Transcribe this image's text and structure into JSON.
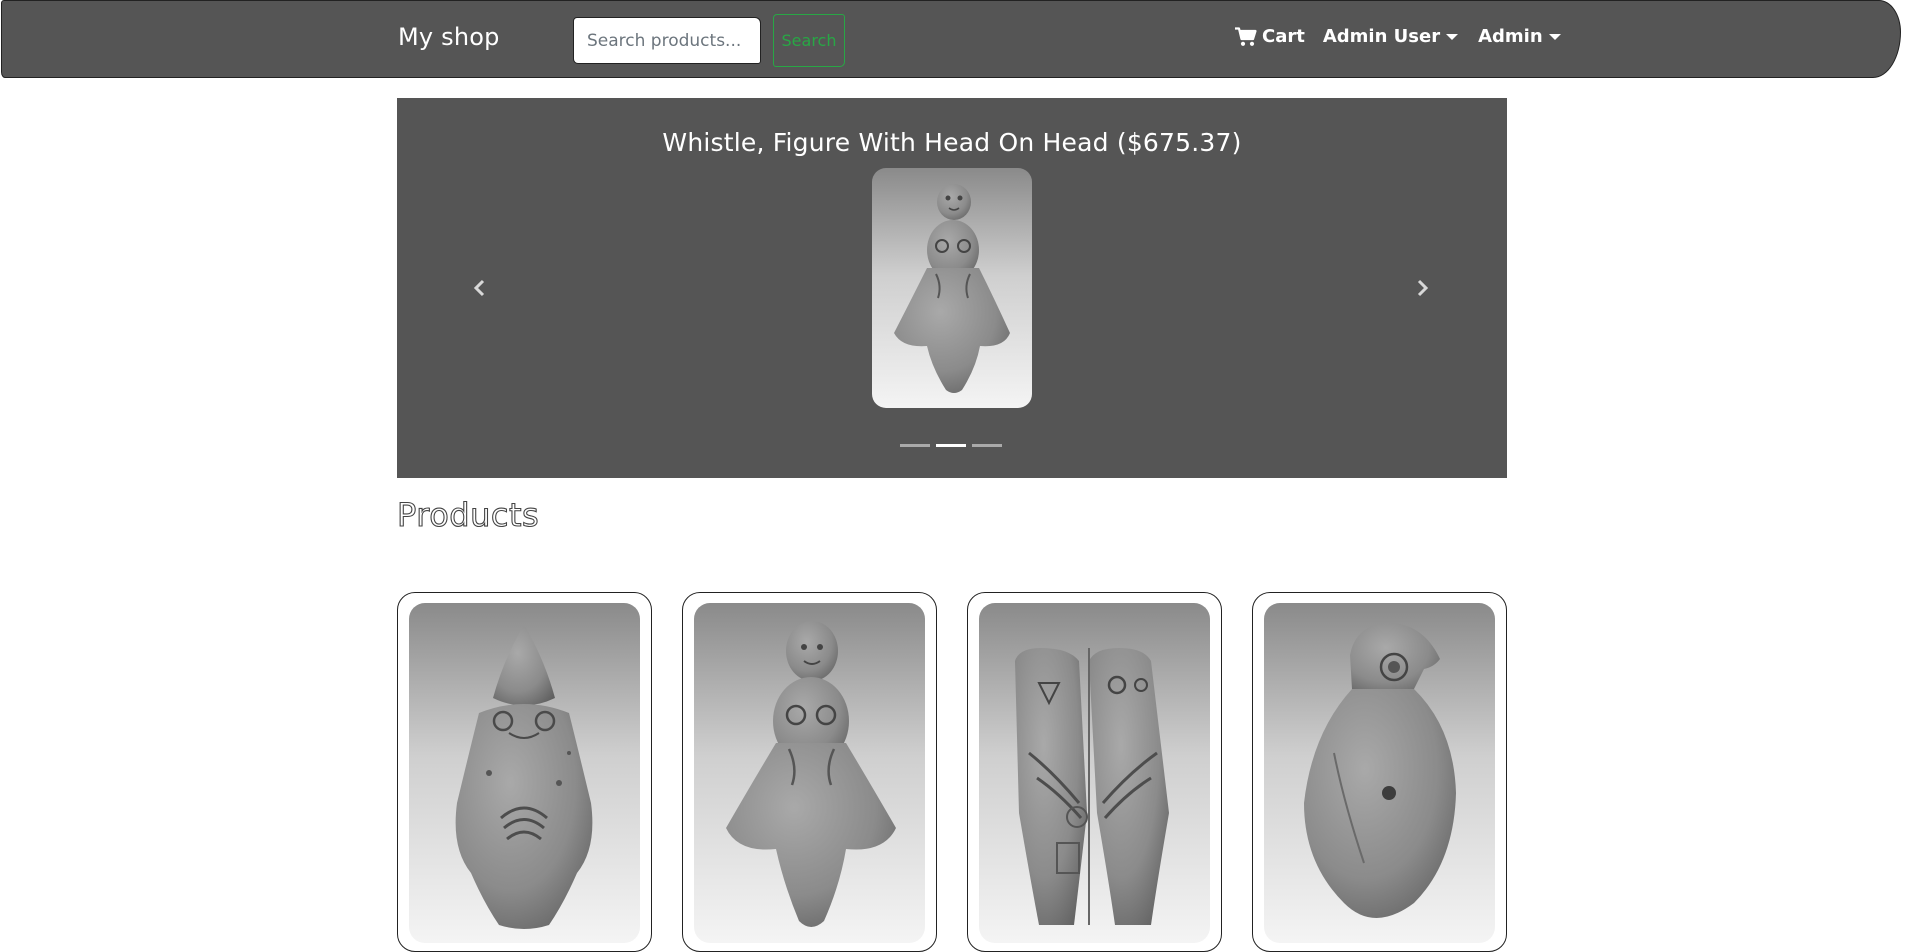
{
  "navbar": {
    "brand": "My shop",
    "search_placeholder": "Search products...",
    "search_button": "Search",
    "cart_label": "Cart",
    "user_menu_label": "Admin User",
    "admin_menu_label": "Admin"
  },
  "carousel": {
    "caption": "Whistle, Figure With Head On Head ($675.37)",
    "active_index": 1,
    "slide_count": 3
  },
  "products": {
    "title": "Products",
    "items": [
      {
        "figure": "figure-with-pointed-hood"
      },
      {
        "figure": "figure-with-head-on-head"
      },
      {
        "figure": "double-figure"
      },
      {
        "figure": "bird-whistle"
      }
    ]
  },
  "icons": {
    "cart": "cart-icon",
    "prev": "chevron-left-icon",
    "next": "chevron-right-icon"
  },
  "colors": {
    "navbar_bg": "#555555",
    "carousel_bg": "#555555",
    "accent_green": "#28a745",
    "text_light": "#ffffff"
  }
}
